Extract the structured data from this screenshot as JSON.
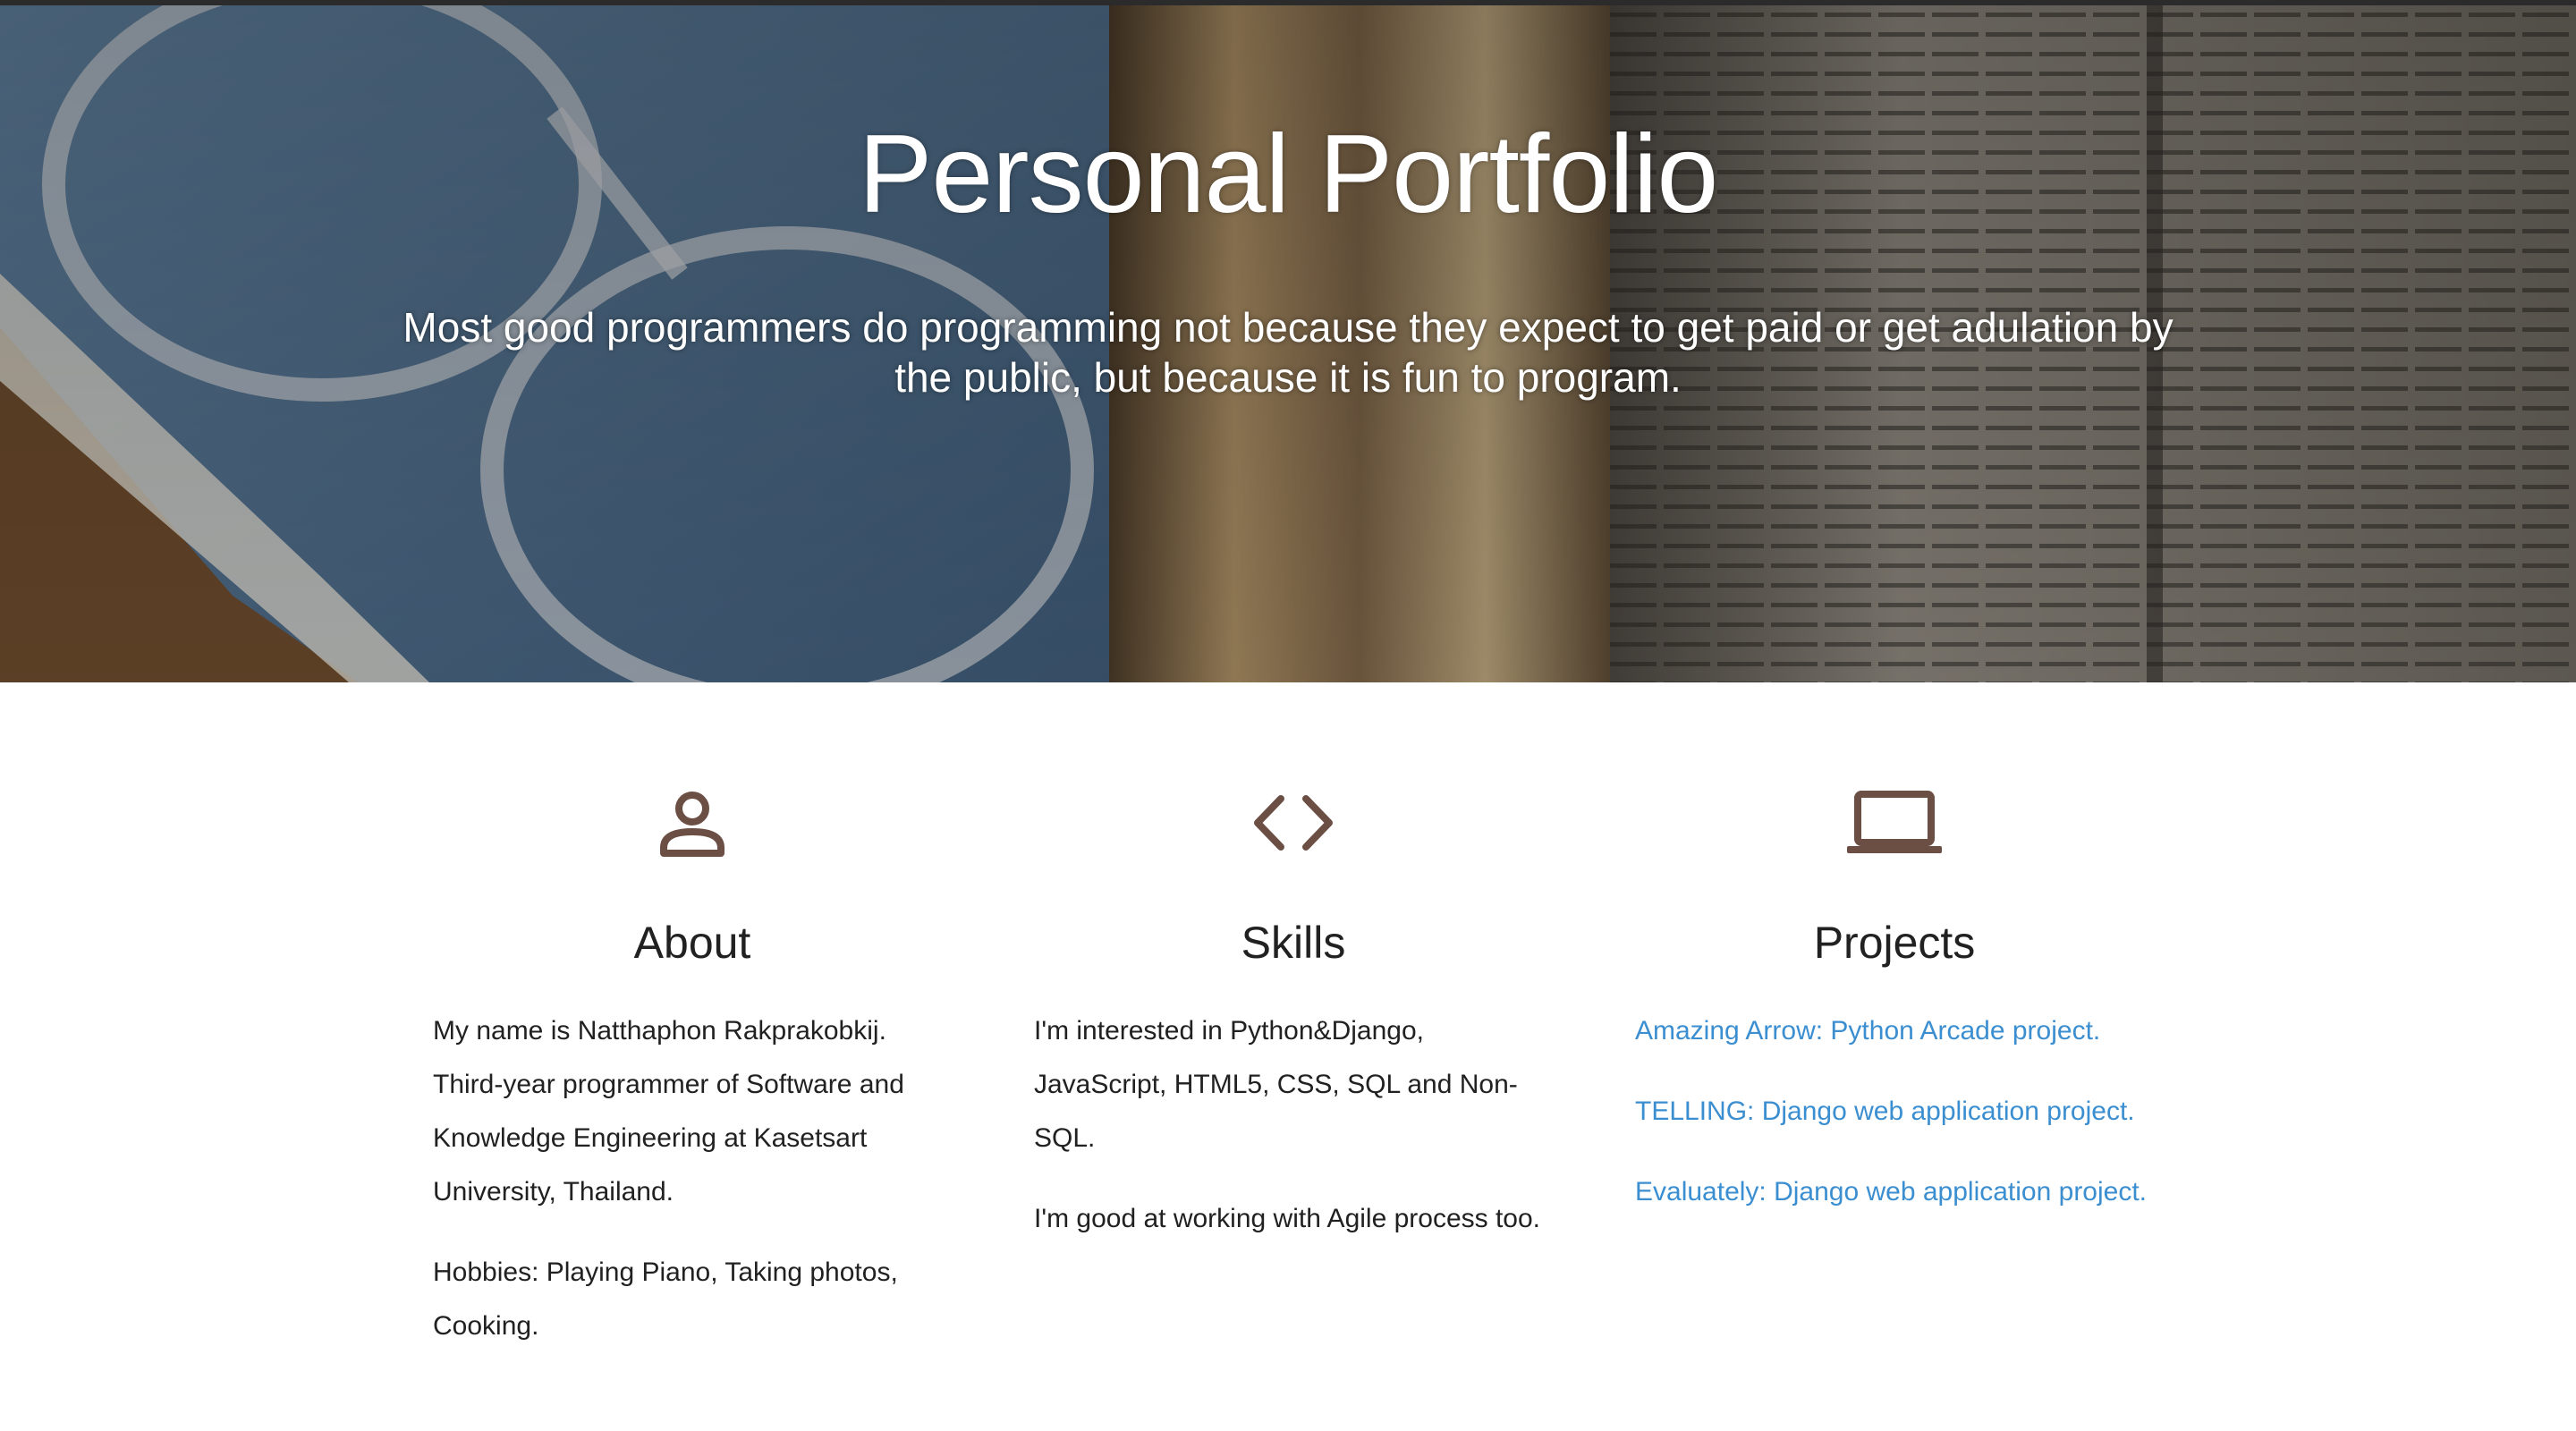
{
  "hero": {
    "title": "Personal Portfolio",
    "quote": "Most good programmers do programming not because they expect to get paid or get adulation by the public, but because it is fun to program."
  },
  "about": {
    "icon": "person-icon",
    "heading": "About",
    "paragraph1": "My name is Natthaphon Rakprakobkij. Third-year programmer of Software and Knowledge Engineering at Kasetsart University, Thailand.",
    "paragraph2": "Hobbies: Playing Piano, Taking photos, Cooking."
  },
  "skills": {
    "icon": "code-icon",
    "heading": "Skills",
    "paragraph1": "I'm interested in Python&Django, JavaScript, HTML5, CSS, SQL and Non-SQL.",
    "paragraph2": "I'm good at working with Agile process too."
  },
  "projects": {
    "icon": "laptop-icon",
    "heading": "Projects",
    "items": [
      "Amazing Arrow: Python Arcade project.",
      "TELLING: Django web application project.",
      "Evaluately: Django web application project."
    ]
  },
  "colors": {
    "icon": "#6b4f45",
    "link": "#3b8ed0",
    "text": "#212121"
  }
}
